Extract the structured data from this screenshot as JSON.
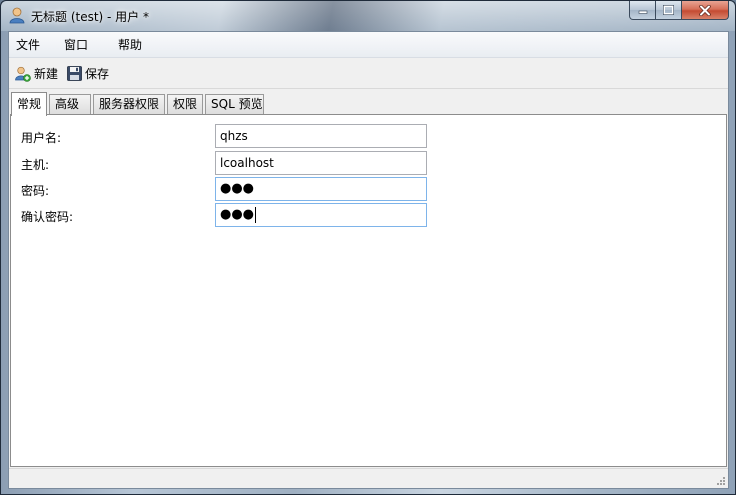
{
  "window": {
    "title": "无标题 (test) - 用户 *",
    "icon": "user-icon"
  },
  "caption": {
    "minimize_icon": "minimize-icon",
    "maximize_icon": "maximize-icon",
    "close_icon": "close-icon"
  },
  "menu": {
    "file": "文件",
    "window": "窗口",
    "help": "帮助"
  },
  "toolbar": {
    "new_label": "新建",
    "new_icon": "add-user-icon",
    "save_label": "保存",
    "save_icon": "floppy-disk-icon"
  },
  "tabs": [
    {
      "label": "常规",
      "active": true
    },
    {
      "label": "高级",
      "active": false
    },
    {
      "label": "服务器权限",
      "active": false
    },
    {
      "label": "权限",
      "active": false
    },
    {
      "label": "SQL 预览",
      "active": false
    }
  ],
  "form": {
    "username_label": "用户名:",
    "username_value": "qhzs",
    "host_label": "主机:",
    "host_value": "lcoalhost",
    "password_label": "密码:",
    "password_value": "●●●",
    "confirm_label": "确认密码:",
    "confirm_value": "●●●"
  },
  "colors": {
    "accent_focus": "#7eb4ea",
    "close_button": "#c44b32"
  }
}
